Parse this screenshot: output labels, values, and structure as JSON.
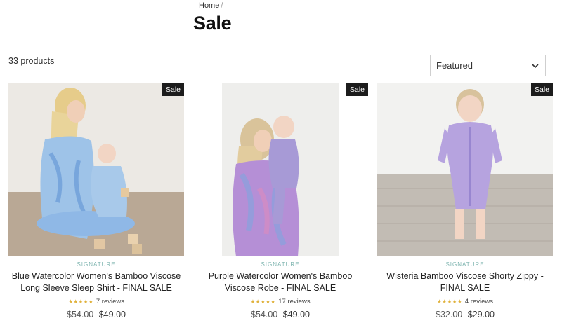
{
  "breadcrumb": {
    "home": "Home",
    "sep": "/"
  },
  "page": {
    "title": "Sale",
    "count": "33 products"
  },
  "sort": {
    "value": "Featured"
  },
  "products": [
    {
      "badge": "Sale",
      "eyebrow": "SIGNATURE",
      "name": "Blue Watercolor Women's Bamboo Viscose Long Sleeve Sleep Shirt - FINAL SALE",
      "stars": "★★★★★",
      "reviews": "7 reviews",
      "old_price": "$54.00",
      "price": "$49.00"
    },
    {
      "badge": "Sale",
      "eyebrow": "SIGNATURE",
      "name": "Purple Watercolor Women's Bamboo Viscose Robe - FINAL SALE",
      "stars": "★★★★★",
      "reviews": "17 reviews",
      "old_price": "$54.00",
      "price": "$49.00"
    },
    {
      "badge": "Sale",
      "eyebrow": "SIGNATURE",
      "name": "Wisteria Bamboo Viscose Shorty Zippy - FINAL SALE",
      "stars": "★★★★★",
      "reviews": "4 reviews",
      "old_price": "$32.00",
      "price": "$29.00"
    }
  ]
}
